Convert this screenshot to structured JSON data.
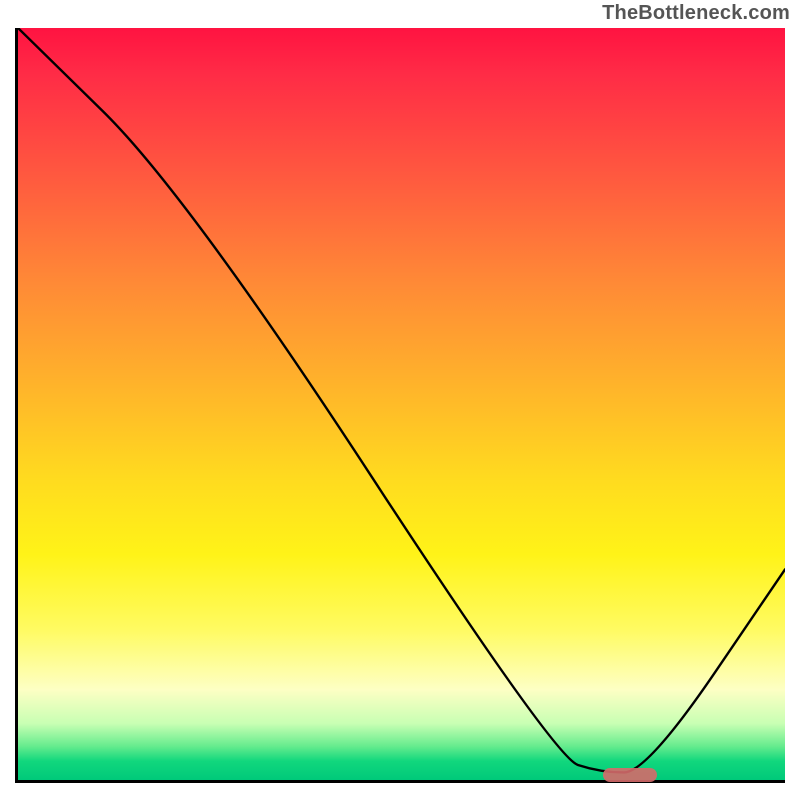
{
  "watermark": "TheBottleneck.com",
  "chart_data": {
    "type": "line",
    "title": "",
    "xlabel": "",
    "ylabel": "",
    "xlim": [
      0,
      100
    ],
    "ylim": [
      0,
      100
    ],
    "x": [
      0,
      22,
      70,
      76,
      82,
      100
    ],
    "values": [
      100,
      78,
      3,
      1,
      1,
      28
    ],
    "marker": {
      "x_start": 76,
      "x_end": 83,
      "y": 1
    },
    "background_gradient": {
      "direction": "top-to-bottom",
      "stops": [
        {
          "pos": 0.0,
          "color": "#ff1341"
        },
        {
          "pos": 0.06,
          "color": "#ff2b46"
        },
        {
          "pos": 0.2,
          "color": "#ff5a3f"
        },
        {
          "pos": 0.34,
          "color": "#ff8a36"
        },
        {
          "pos": 0.48,
          "color": "#ffb52a"
        },
        {
          "pos": 0.6,
          "color": "#ffdb1f"
        },
        {
          "pos": 0.7,
          "color": "#fff318"
        },
        {
          "pos": 0.8,
          "color": "#fffb62"
        },
        {
          "pos": 0.88,
          "color": "#fdffc4"
        },
        {
          "pos": 0.925,
          "color": "#c8ffb3"
        },
        {
          "pos": 0.955,
          "color": "#66ec8e"
        },
        {
          "pos": 0.975,
          "color": "#11d77d"
        },
        {
          "pos": 1.0,
          "color": "#00c97a"
        }
      ]
    }
  },
  "marker_color": "#d56a6a"
}
